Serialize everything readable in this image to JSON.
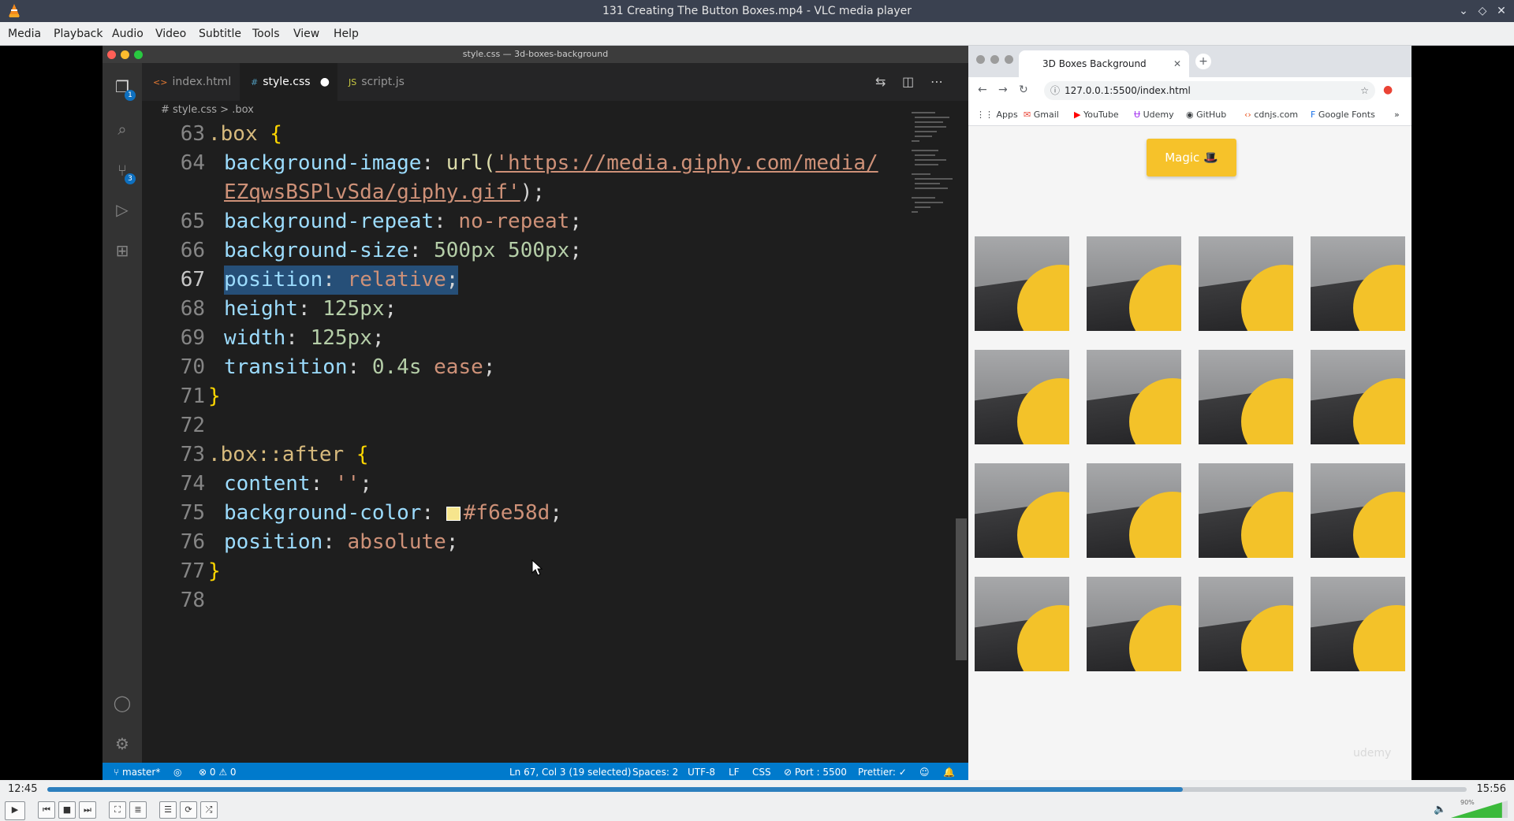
{
  "window": {
    "title": "131 Creating The Button Boxes.mp4 - VLC media player",
    "controls": [
      "⌄",
      "◇",
      "✕"
    ]
  },
  "menu": [
    "Media",
    "Playback",
    "Audio",
    "Video",
    "Subtitle",
    "Tools",
    "View",
    "Help"
  ],
  "vscode": {
    "title": "style.css — 3d-boxes-background",
    "tabs": [
      {
        "icon": "<>",
        "label": "index.html"
      },
      {
        "icon": "#",
        "label": "style.css"
      },
      {
        "icon": "JS",
        "label": "script.js"
      }
    ],
    "badges": {
      "explorer": "1",
      "scm": "3"
    },
    "breadcrumb": {
      "file": "# style.css",
      "sep": ">",
      "symbol": ".box"
    },
    "lines": {
      "n63": "63",
      "n64": "64",
      "n65": "65",
      "n66": "66",
      "n67": "67",
      "n68": "68",
      "n69": "69",
      "n70": "70",
      "n71": "71",
      "n72": "72",
      "n73": "73",
      "n74": "74",
      "n75": "75",
      "n76": "76",
      "n77": "77",
      "n78": "78",
      "l63_sel": ".box",
      "l63_brace": "{",
      "l64_prop": "background-image",
      "l64_colon": ":",
      "l64_fn": "url(",
      "l64_url1": "'https://media.giphy.com/media/",
      "l64b_url2": "EZqwsBSPlvSda/giphy.gif'",
      "l64b_end": ");",
      "l65_prop": "background-repeat",
      "l65_colon": ":",
      "l65_val": "no-repeat",
      "l65_end": ";",
      "l66_prop": "background-size",
      "l66_colon": ":",
      "l66_val": "500px 500px",
      "l66_end": ";",
      "l67_prop": "position",
      "l67_colon": ":",
      "l67_val": "relative",
      "l67_end": ";",
      "l68_prop": "height",
      "l68_colon": ":",
      "l68_val": "125px",
      "l68_end": ";",
      "l69_prop": "width",
      "l69_colon": ":",
      "l69_val": "125px",
      "l69_end": ";",
      "l70_prop": "transition",
      "l70_colon": ":",
      "l70_num": "0.4s",
      "l70_val": "ease",
      "l70_end": ";",
      "l71_brace": "}",
      "l73_sel": ".box::after",
      "l73_brace": "{",
      "l74_prop": "content",
      "l74_colon": ":",
      "l74_val": "''",
      "l74_end": ";",
      "l75_prop": "background-color",
      "l75_colon": ":",
      "l75_val": "#f6e58d",
      "l75_end": ";",
      "l76_prop": "position",
      "l76_colon": ":",
      "l76_val": "absolute",
      "l76_end": ";",
      "l77_brace": "}"
    },
    "swatch_color": "#f6e58d",
    "status": {
      "branch": "master*",
      "problems": "⊗ 0 ⚠ 0",
      "cursor": "Ln 67, Col 3 (19 selected)",
      "spaces": "Spaces: 2",
      "encoding": "UTF-8",
      "eol": "LF",
      "language": "CSS",
      "port": "⊘ Port : 5500",
      "prettier": "Prettier: ✓"
    }
  },
  "browser": {
    "tab_title": "3D Boxes Background",
    "url": "127.0.0.1:5500/index.html",
    "bookmarks": [
      "Apps",
      "Gmail",
      "YouTube",
      "Udemy",
      "GitHub",
      "cdnjs.com",
      "Google Fonts"
    ],
    "magic_label": "Magic 🎩",
    "watermark": "udemy",
    "box_count": 16
  },
  "player": {
    "time_current": "12:45",
    "time_total": "15:56",
    "progress": 0.8,
    "volume_label": "90%",
    "volume_level": 0.9,
    "accent": "#2c7fbe"
  }
}
